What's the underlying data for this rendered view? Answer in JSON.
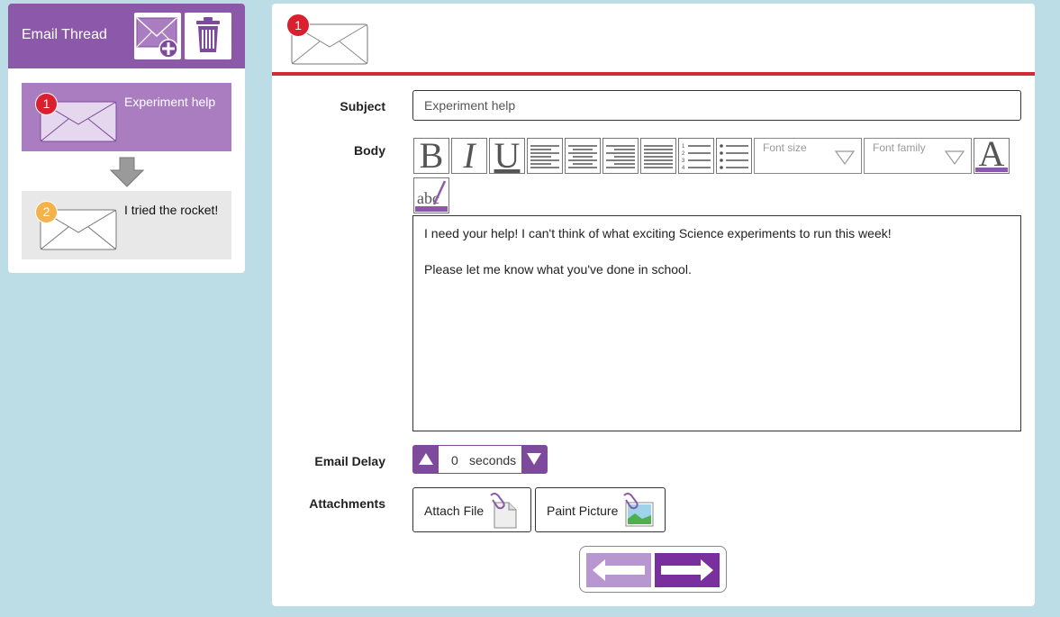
{
  "thread": {
    "title": "Email Thread",
    "items": [
      {
        "number": "1",
        "label": "Experiment help"
      },
      {
        "number": "2",
        "label": "I tried the rocket!"
      }
    ]
  },
  "editor": {
    "badge": "1",
    "subject_label": "Subject",
    "subject_value": "Experiment help",
    "body_label": "Body",
    "toolbar": {
      "bold": "B",
      "italic": "I",
      "underline": "U",
      "font_color": "A",
      "font_size_placeholder": "Font size",
      "font_family_placeholder": "Font family",
      "spellcheck_text": "abc"
    },
    "body_lines": [
      "I need your help! I can't think of what exciting Science experiments to run this week!",
      "Please let me know what you've done in school."
    ],
    "delay_label": "Email Delay",
    "delay_value": "0",
    "delay_unit": "seconds",
    "attachments_label": "Attachments",
    "attach_file": "Attach File",
    "paint_picture": "Paint Picture"
  },
  "colors": {
    "accent_purple": "#8c58a9",
    "header_line_red": "#d02c3a",
    "badge_red": "#d8202f",
    "badge_orange": "#f4b34a",
    "background": "#bcdce6"
  }
}
